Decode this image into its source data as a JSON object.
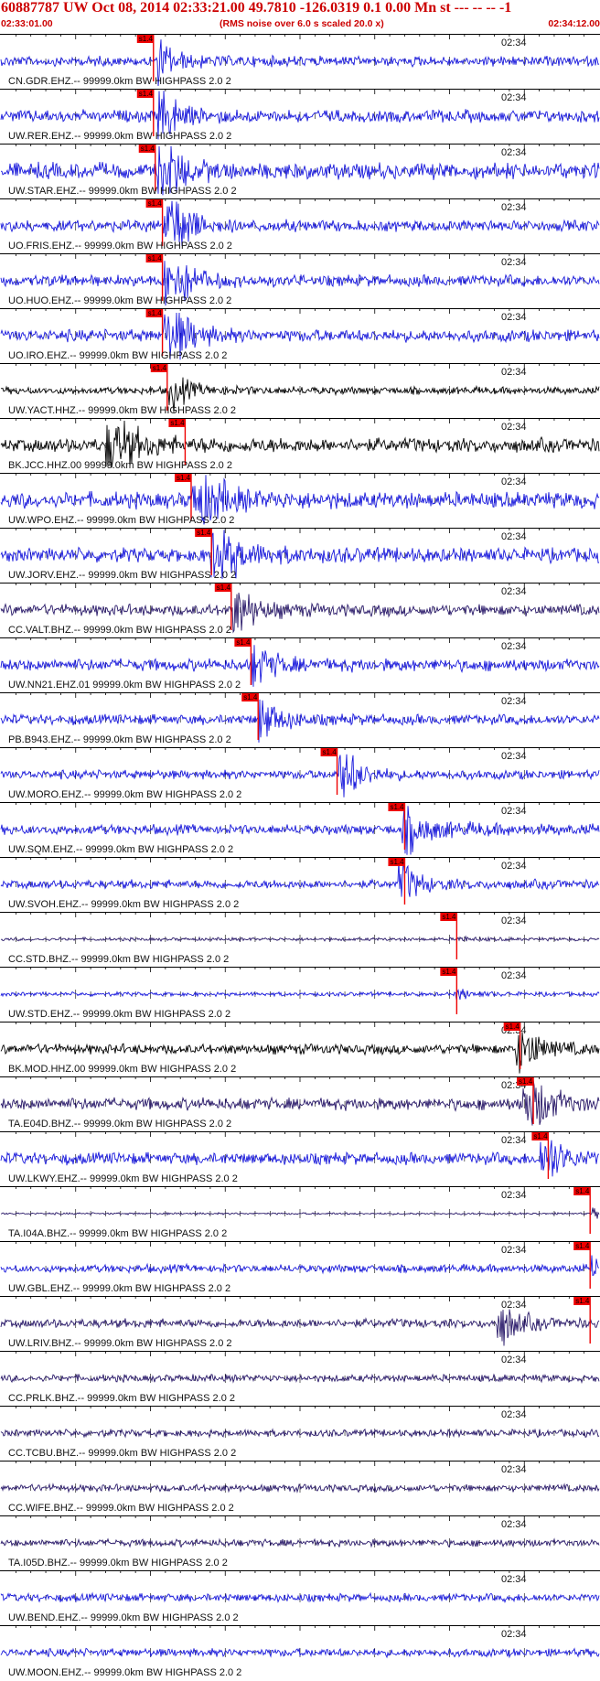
{
  "header": {
    "title": "60887787 UW Oct 08, 2014 02:33:21.00   49.7810 -126.0319  0.1 0.00 Mn st --- -- --  -1",
    "start_time": "02:33:01.00",
    "note": "(RMS noise over 6.0 s scaled 20.0 x)",
    "end_time": "02:34:12.00"
  },
  "colors": {
    "header_text": "#cc0000",
    "pick": "#ee0000",
    "blue": "#1a1adc",
    "black": "#000000",
    "navy": "#2a1a6a"
  },
  "chart_data": {
    "type": "seismogram",
    "time_range": [
      "02:33:01.00",
      "02:34:12.00"
    ],
    "tick_label": "02:34",
    "pick_label": "s1.4",
    "traces": [
      {
        "label": "CN.GDR.EHZ.-- 99999.0km BW  HIGHPASS  2.0  2",
        "color": "blue",
        "pick": 0.255,
        "onset": 0.262,
        "amp": 0.25,
        "burst": 0.8,
        "tail": 0.1
      },
      {
        "label": "UW.RER.EHZ.-- 99999.0km BW  HIGHPASS  2.0  2",
        "color": "blue",
        "pick": 0.255,
        "onset": 0.262,
        "amp": 0.3,
        "burst": 1.0,
        "tail": 0.15
      },
      {
        "label": "UW.STAR.EHZ.-- 99999.0km BW  HIGHPASS  2.0  2",
        "color": "blue",
        "pick": 0.258,
        "onset": 0.262,
        "amp": 0.4,
        "burst": 1.2,
        "tail": 0.15
      },
      {
        "label": "UO.FRIS.EHZ.-- 99999.0km BW  HIGHPASS  2.0  2",
        "color": "blue",
        "pick": 0.27,
        "onset": 0.272,
        "amp": 0.28,
        "burst": 2.5,
        "tail": 0.1
      },
      {
        "label": "UO.HUO.EHZ.-- 99999.0km BW  HIGHPASS  2.0  2",
        "color": "blue",
        "pick": 0.27,
        "onset": 0.272,
        "amp": 0.28,
        "burst": 2.2,
        "tail": 0.1
      },
      {
        "label": "UO.IRO.EHZ.-- 99999.0km BW  HIGHPASS  2.0  2",
        "color": "blue",
        "pick": 0.27,
        "onset": 0.272,
        "amp": 0.3,
        "burst": 2.0,
        "tail": 0.1
      },
      {
        "label": "UW.YACT.HHZ.-- 99999.0km BW  HIGHPASS  2.0  2",
        "color": "black",
        "pick": 0.278,
        "onset": 0.28,
        "amp": 0.18,
        "burst": 0.9,
        "tail": 0.3
      },
      {
        "label": "BK.JCC.HHZ.00 99999.0km BW  HIGHPASS  2.0  2",
        "color": "black",
        "pick": 0.308,
        "onset": 0.175,
        "amp": 0.35,
        "burst": 1.4,
        "tail": 0.35
      },
      {
        "label": "UW.WPO.EHZ.-- 99999.0km BW  HIGHPASS  2.0  2",
        "color": "blue",
        "pick": 0.318,
        "onset": 0.32,
        "amp": 0.4,
        "burst": 1.6,
        "tail": 0.25
      },
      {
        "label": "UW.JORV.EHZ.-- 99999.0km BW  HIGHPASS  2.0  2",
        "color": "blue",
        "pick": 0.352,
        "onset": 0.35,
        "amp": 0.35,
        "burst": 1.7,
        "tail": 0.35
      },
      {
        "label": "CC.VALT.BHZ.-- 99999.0km BW  HIGHPASS  2.0  2",
        "color": "navy",
        "pick": 0.385,
        "onset": 0.387,
        "amp": 0.28,
        "burst": 1.1,
        "tail": 0.2
      },
      {
        "label": "UW.NN21.EHZ.01 99999.0km BW  HIGHPASS  2.0  2",
        "color": "blue",
        "pick": 0.418,
        "onset": 0.418,
        "amp": 0.3,
        "burst": 0.8,
        "tail": 0.15
      },
      {
        "label": "PB.B943.EHZ.-- 99999.0km BW  HIGHPASS  2.0  2",
        "color": "blue",
        "pick": 0.43,
        "onset": 0.43,
        "amp": 0.25,
        "burst": 1.0,
        "tail": 0.15
      },
      {
        "label": "UW.MORO.EHZ.-- 99999.0km BW  HIGHPASS  2.0  2",
        "color": "blue",
        "pick": 0.562,
        "onset": 0.565,
        "amp": 0.22,
        "burst": 1.6,
        "tail": 0.15
      },
      {
        "label": "UW.SQM.EHZ.-- 99999.0km BW  HIGHPASS  2.0  2",
        "color": "blue",
        "pick": 0.675,
        "onset": 0.67,
        "amp": 0.25,
        "burst": 1.0,
        "tail": 0.5
      },
      {
        "label": "UW.SVOH.EHZ.-- 99999.0km BW  HIGHPASS  2.0  2",
        "color": "blue",
        "pick": 0.675,
        "onset": 0.665,
        "amp": 0.22,
        "burst": 1.0,
        "tail": 0.15
      },
      {
        "label": "CC.STD.BHZ.-- 99999.0km BW  HIGHPASS  2.0  2",
        "color": "navy",
        "pick": 0.762,
        "onset": 0.76,
        "amp": 0.08,
        "burst": 0.3,
        "tail": 0.05
      },
      {
        "label": "UW.STD.EHZ.-- 99999.0km BW  HIGHPASS  2.0  2",
        "color": "blue",
        "pick": 0.762,
        "onset": 0.76,
        "amp": 0.1,
        "burst": 0.5,
        "tail": 0.05
      },
      {
        "label": "BK.MOD.HHZ.00 99999.0km BW  HIGHPASS  2.0  2",
        "color": "black",
        "pick": 0.868,
        "onset": 0.86,
        "amp": 0.25,
        "burst": 1.6,
        "tail": 0.2
      },
      {
        "label": "TA.E04D.BHZ.-- 99999.0km BW  HIGHPASS  2.0  2",
        "color": "navy",
        "pick": 0.89,
        "onset": 0.87,
        "amp": 0.3,
        "burst": 1.9,
        "tail": 0.4
      },
      {
        "label": "UW.LKWY.EHZ.-- 99999.0km BW  HIGHPASS  2.0  2",
        "color": "blue",
        "pick": 0.915,
        "onset": 0.9,
        "amp": 0.3,
        "burst": 1.2,
        "tail": 0.2
      },
      {
        "label": "TA.I04A.BHZ.-- 99999.0km BW  HIGHPASS  2.0  2",
        "color": "navy",
        "pick": 0.985,
        "onset": 0.985,
        "amp": 0.05,
        "burst": 1.0,
        "tail": 0.0
      },
      {
        "label": "UW.GBL.EHZ.-- 99999.0km BW  HIGHPASS  2.0  2",
        "color": "blue",
        "pick": 0.985,
        "onset": 0.985,
        "amp": 0.2,
        "burst": 0.6,
        "tail": 0.0
      },
      {
        "label": "UW.LRIV.BHZ.-- 99999.0km BW  HIGHPASS  2.0  2",
        "color": "navy",
        "pick": 0.985,
        "onset": 0.83,
        "amp": 0.22,
        "burst": 1.2,
        "tail": 0.2
      },
      {
        "label": "CC.PRLK.BHZ.-- 99999.0km BW  HIGHPASS  2.0  2",
        "color": "navy",
        "pick": null,
        "onset": null,
        "amp": 0.18,
        "burst": 0,
        "tail": 0
      },
      {
        "label": "CC.TCBU.BHZ.-- 99999.0km BW  HIGHPASS  2.0  2",
        "color": "navy",
        "pick": null,
        "onset": null,
        "amp": 0.18,
        "burst": 0,
        "tail": 0
      },
      {
        "label": "CC.WIFE.BHZ.-- 99999.0km BW  HIGHPASS  2.0  2",
        "color": "navy",
        "pick": null,
        "onset": null,
        "amp": 0.18,
        "burst": 0,
        "tail": 0
      },
      {
        "label": "TA.I05D.BHZ.-- 99999.0km BW  HIGHPASS  2.0  2",
        "color": "navy",
        "pick": null,
        "onset": null,
        "amp": 0.18,
        "burst": 0,
        "tail": 0
      },
      {
        "label": "UW.BEND.EHZ.-- 99999.0km BW  HIGHPASS  2.0  2",
        "color": "blue",
        "pick": null,
        "onset": null,
        "amp": 0.2,
        "burst": 0,
        "tail": 0
      },
      {
        "label": "UW.MOON.EHZ.-- 99999.0km BW  HIGHPASS  2.0  2",
        "color": "blue",
        "pick": null,
        "onset": null,
        "amp": 0.2,
        "burst": 0,
        "tail": 0
      }
    ]
  }
}
